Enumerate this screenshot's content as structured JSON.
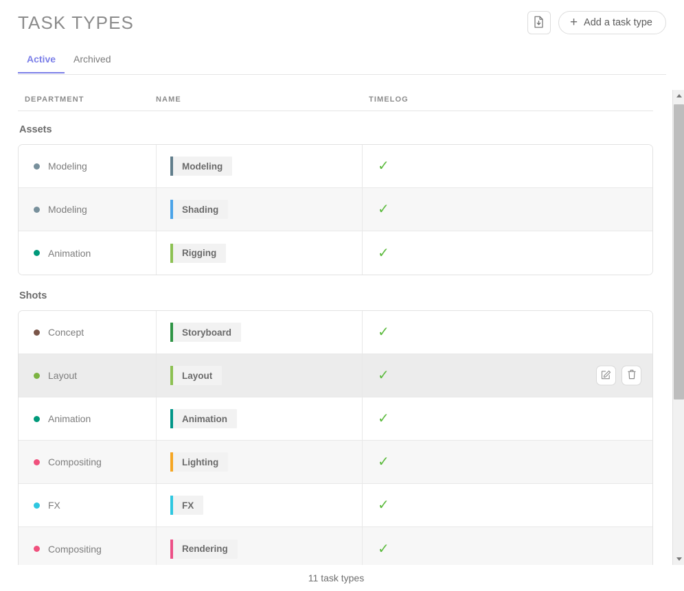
{
  "header": {
    "title": "TASK TYPES",
    "export_icon": "file-download-icon",
    "add_label": "Add a task type",
    "plus_icon": "plus-icon"
  },
  "tabs": [
    {
      "label": "Active",
      "active": true
    },
    {
      "label": "Archived",
      "active": false
    }
  ],
  "columns": {
    "department": "DEPARTMENT",
    "name": "NAME",
    "timelog": "TIMELOG"
  },
  "groups": [
    {
      "title": "Assets",
      "rows": [
        {
          "department": "Modeling",
          "dept_color": "#78909c",
          "name": "Modeling",
          "name_color": "#607d8b",
          "timelog": true,
          "hovered": false
        },
        {
          "department": "Modeling",
          "dept_color": "#78909c",
          "name": "Shading",
          "name_color": "#4aa3e8",
          "timelog": true,
          "hovered": false
        },
        {
          "department": "Animation",
          "dept_color": "#00997a",
          "name": "Rigging",
          "name_color": "#8cc152",
          "timelog": true,
          "hovered": false
        }
      ]
    },
    {
      "title": "Shots",
      "rows": [
        {
          "department": "Concept",
          "dept_color": "#7a5548",
          "name": "Storyboard",
          "name_color": "#2e9444",
          "timelog": true,
          "hovered": false
        },
        {
          "department": "Layout",
          "dept_color": "#7cb342",
          "name": "Layout",
          "name_color": "#8cc152",
          "timelog": true,
          "hovered": true
        },
        {
          "department": "Animation",
          "dept_color": "#00997a",
          "name": "Animation",
          "name_color": "#009688",
          "timelog": true,
          "hovered": false
        },
        {
          "department": "Compositing",
          "dept_color": "#f0517d",
          "name": "Lighting",
          "name_color": "#f5a623",
          "timelog": true,
          "hovered": false
        },
        {
          "department": "FX",
          "dept_color": "#2ec7e0",
          "name": "FX",
          "name_color": "#2ec7e0",
          "timelog": true,
          "hovered": false
        },
        {
          "department": "Compositing",
          "dept_color": "#f0517d",
          "name": "Rendering",
          "name_color": "#ec4f86",
          "timelog": true,
          "hovered": false
        }
      ]
    }
  ],
  "row_actions": {
    "edit_icon": "edit-icon",
    "delete_icon": "trash-icon"
  },
  "timelog_check": "✓",
  "footer": {
    "count_label": "11 task types"
  },
  "colors": {
    "accent": "#7b7fe8",
    "check_green": "#5dbb3f",
    "title_gray": "#8b8b8b",
    "row_alt": "#f7f7f7",
    "row_hover": "#ececec"
  },
  "scrollbar": {
    "up_icon": "chevron-up-icon",
    "down_icon": "chevron-down-icon"
  }
}
